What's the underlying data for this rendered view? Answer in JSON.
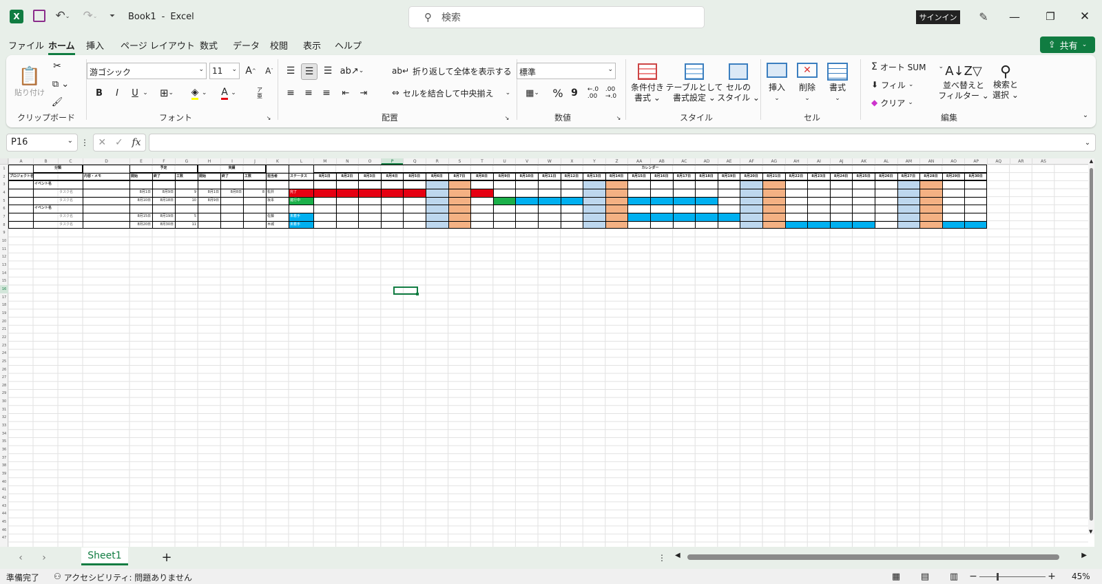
{
  "title": {
    "app_icon": "excel-icon",
    "doc": "Book1",
    "sep": "-",
    "app": "Excel",
    "search_placeholder": "検索",
    "signin": "サインイン",
    "share": "共有"
  },
  "menu": {
    "tabs": [
      "ファイル",
      "ホーム",
      "挿入",
      "ページ レイアウト",
      "数式",
      "データ",
      "校閲",
      "表示",
      "ヘルプ"
    ],
    "active": "ホーム"
  },
  "ribbon": {
    "clipboard": {
      "paste": "貼り付け",
      "label": "クリップボード"
    },
    "font": {
      "name": "游ゴシック",
      "size": "11",
      "label": "フォント",
      "bold": "B",
      "italic": "I",
      "underline": "U",
      "phonetic_top": "ア",
      "phonetic_bottom": "亜"
    },
    "align": {
      "wrap": "折り返して全体を表示する",
      "merge": "セルを結合して中央揃え",
      "label": "配置"
    },
    "number": {
      "format": "標準",
      "percent": "%",
      "comma": "9",
      "label": "数値"
    },
    "style": {
      "cond1": "条件付き",
      "cond2": "書式",
      "table1": "テーブルとして",
      "table2": "書式設定",
      "cell1": "セルの",
      "cell2": "スタイル",
      "label": "スタイル"
    },
    "cells": {
      "insert": "挿入",
      "delete": "削除",
      "format": "書式",
      "label": "セル"
    },
    "edit": {
      "autosum": "オート SUM",
      "fill": "フィル",
      "clear": "クリア",
      "sort1": "並べ替えと",
      "sort2": "フィルター",
      "find1": "検索と",
      "find2": "選択",
      "label": "編集"
    }
  },
  "formula_bar": {
    "name_box": "P16",
    "fx": "fx",
    "content": ""
  },
  "columns": [
    "A",
    "B",
    "C",
    "D",
    "E",
    "F",
    "G",
    "H",
    "I",
    "J",
    "K",
    "L",
    "M",
    "N",
    "O",
    "P",
    "Q",
    "R",
    "S",
    "T",
    "U",
    "V",
    "W",
    "X",
    "Y",
    "Z",
    "AA",
    "AB",
    "AC",
    "AD",
    "AE",
    "AF",
    "AG",
    "AH",
    "AI",
    "AJ",
    "AK",
    "AL",
    "AM",
    "AN",
    "AO",
    "AP",
    "AQ",
    "AR",
    "AS"
  ],
  "sheet": {
    "header1": {
      "bunrui": "分類",
      "yotei": "予定",
      "jisseki": "実績",
      "calendar": "カレンダー"
    },
    "header2": [
      "プロジェクト名",
      "内容・メモ",
      "開始",
      "終了",
      "工数",
      "開始",
      "終了",
      "工数",
      "担当者",
      "ステータス"
    ],
    "dates": [
      "8月1日",
      "8月2日",
      "8月3日",
      "8月4日",
      "8月5日",
      "8月6日",
      "8月7日",
      "8月8日",
      "8月9日",
      "8月10日",
      "8月11日",
      "8月12日",
      "8月13日",
      "8月14日",
      "8月15日",
      "8月16日",
      "8月17日",
      "8月18日",
      "8月19日",
      "8月20日",
      "8月21日",
      "8月22日",
      "8月23日",
      "8月24日",
      "8月25日",
      "8月26日",
      "8月27日",
      "8月28日",
      "8月29日",
      "8月30日"
    ],
    "rows": [
      {
        "b": "イベント名",
        "c": "",
        "e": "",
        "f": "",
        "g": "",
        "h": "",
        "i": "",
        "j": "",
        "k": "",
        "l": ""
      },
      {
        "b": "",
        "c": "タスク名",
        "e": "8月1日",
        "f": "8月9日",
        "g": "9",
        "h": "8月1日",
        "i": "8月8日",
        "j": "8",
        "k": "松井",
        "l": "完了"
      },
      {
        "b": "",
        "c": "タスク名",
        "e": "8月10日",
        "f": "8月18日",
        "g": "10",
        "h": "8月9日",
        "i": "",
        "j": "",
        "k": "坂本",
        "l": "進行中"
      },
      {
        "b": "イベント名",
        "c": "",
        "e": "",
        "f": "",
        "g": "",
        "h": "",
        "i": "",
        "j": "",
        "k": "",
        "l": ""
      },
      {
        "b": "",
        "c": "タスク名",
        "e": "8月15日",
        "f": "8月19日",
        "g": "5",
        "h": "",
        "i": "",
        "j": "",
        "k": "佐藤",
        "l": "未着手"
      },
      {
        "b": "",
        "c": "タスク名",
        "e": "8月20日",
        "f": "8月30日",
        "g": "11",
        "h": "",
        "i": "",
        "j": "",
        "k": "木城",
        "l": "未着手"
      }
    ],
    "row_labels": [
      "1",
      "2",
      "3",
      "4",
      "5",
      "6",
      "7",
      "8",
      "9",
      "10",
      "11",
      "12",
      "13",
      "14",
      "15",
      "16",
      "17",
      "18",
      "19",
      "20",
      "21",
      "22",
      "23",
      "24",
      "25",
      "26",
      "27",
      "28",
      "29",
      "30",
      "31",
      "32",
      "33",
      "34",
      "35",
      "36",
      "37",
      "38",
      "39",
      "40",
      "41",
      "42",
      "43",
      "44",
      "45",
      "46",
      "47"
    ],
    "selected_cell": "P16"
  },
  "colors": {
    "accent": "#107c41",
    "done": "#e60012",
    "progress": "#1bb04a",
    "todo": "#00b0f0",
    "saturday": "#bdd7ee",
    "sunday": "#f4b183"
  },
  "sheets": {
    "tabs": [
      "Sheet1"
    ],
    "add": "+"
  },
  "status": {
    "ready": "準備完了",
    "access": "アクセシビリティ: 問題ありません",
    "zoom": "45%"
  }
}
